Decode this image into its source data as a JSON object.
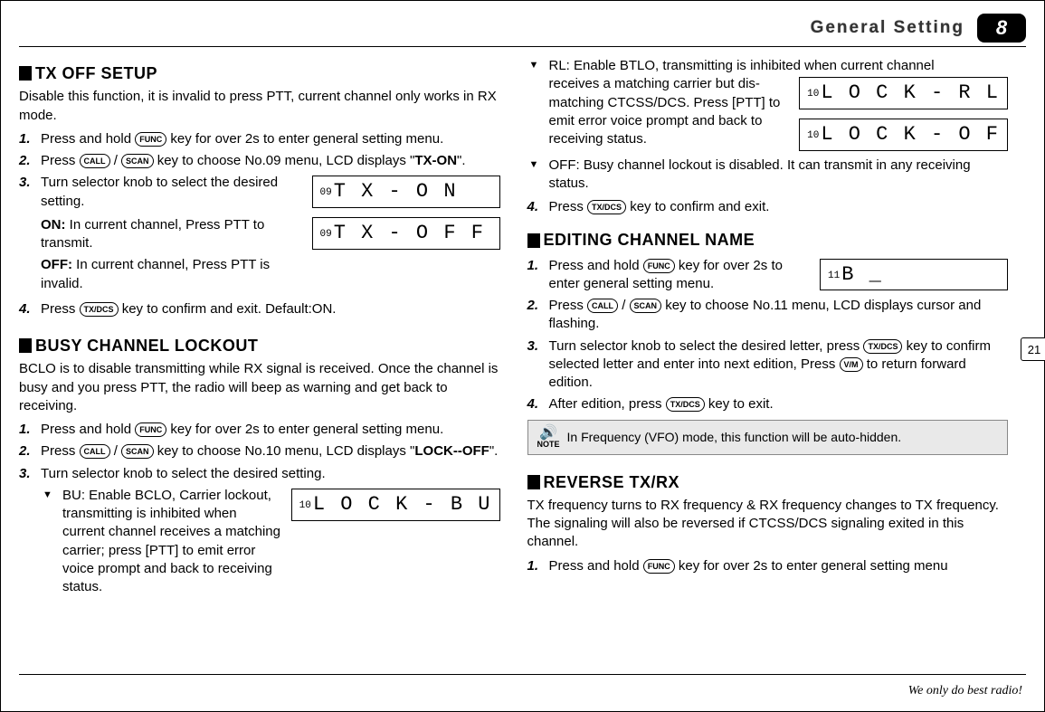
{
  "header": {
    "title": "General Setting",
    "chapter": "8"
  },
  "page_number": "21",
  "slogan": "We only do best radio!",
  "tx_off": {
    "heading": "TX OFF SETUP",
    "intro": "Disable this function, it is invalid to press PTT, current channel only works in RX mode.",
    "step1_a": "Press and hold ",
    "step1_b": " key for over 2s to enter general setting menu.",
    "step2_a": "Press ",
    "step2_b": " / ",
    "step2_c": " key to choose No.09 menu, LCD displays \"",
    "step2_d": "TX-ON",
    "step2_e": "\".",
    "step3_a": "Turn selector knob to select the desired setting.",
    "step3_on_a": "ON:",
    "step3_on_b": " In current channel, Press PTT to transmit.",
    "step3_off_a": "OFF:",
    "step3_off_b": " In current channel, Press PTT is invalid.",
    "step4_a": "Press ",
    "step4_b": " key to confirm and exit. Default:ON.",
    "lcd_on_prefix": "09",
    "lcd_on": "T X - O N",
    "lcd_off_prefix": "09",
    "lcd_off": "T X - O F F"
  },
  "bclo": {
    "heading": "BUSY CHANNEL LOCKOUT",
    "intro": "BCLO is to disable transmitting while RX signal is received. Once the channel is busy and you press PTT, the radio will beep as warning and get back to receiving.",
    "step1_a": "Press and hold ",
    "step1_b": " key for over 2s to enter general setting menu.",
    "step2_a": "Press ",
    "step2_b": " / ",
    "step2_c": " key to choose No.10 menu, LCD displays \"",
    "step2_d": "LOCK--OFF",
    "step2_e": "\".",
    "step3": "Turn selector knob to select the desired setting.",
    "bu_text_a": "BU: Enable BCLO, Carrier lockout, transmitting is inhibited when current channel receives a matching carrier; press [PTT] to emit error voice prompt and back to",
    "bu_text_b": "  receiving status.",
    "rl_text_a": "RL: Enable BTLO, transmitting is inhibited when current channel",
    "rl_text_b": " receives a matching carrier but dis-matching CTCSS/DCS. Press [PTT] to emit error voice prompt and back to receiving status.",
    "off_text": "OFF: Busy channel lockout is disabled. It can transmit in any receiving status.",
    "step4_a": "Press ",
    "step4_b": " key to confirm and exit.",
    "lcd_bu_prefix": "10",
    "lcd_bu": "L O C K - B U",
    "lcd_rl_prefix": "10",
    "lcd_rl": "L O C K - R L",
    "lcd_off_prefix": "10",
    "lcd_off": "L O C K - O F"
  },
  "edit_name": {
    "heading": "EDITING CHANNEL NAME",
    "step1_a": "Press and hold ",
    "step1_b": " key for over 2s to enter general setting menu.",
    "step2_a": "Press ",
    "step2_b": " / ",
    "step2_c": " key to choose No.11 menu, LCD displays cursor and flashing.",
    "step3_a": "Turn selector knob to select the desired letter, press ",
    "step3_b": " key to confirm selected letter and enter into next edition, Press ",
    "step3_c": " to return forward edition.",
    "step4_a": "After edition, press ",
    "step4_b": " key to exit.",
    "lcd_prefix": "11",
    "lcd": "B _",
    "note": "In Frequency (VFO) mode, this function will be auto-hidden.",
    "note_label": "NOTE"
  },
  "reverse": {
    "heading": "REVERSE TX/RX",
    "intro": "TX frequency turns to RX frequency & RX frequency changes to TX frequency. The signaling will also be reversed if CTCSS/DCS signaling exited in this channel.",
    "step1_a": "Press and hold ",
    "step1_b": " key for over 2s to enter general setting menu"
  },
  "keys": {
    "func": "FUNC",
    "call": "CALL",
    "scan": "SCAN",
    "txdcs": "TX/DCS",
    "vm": "V/M"
  }
}
